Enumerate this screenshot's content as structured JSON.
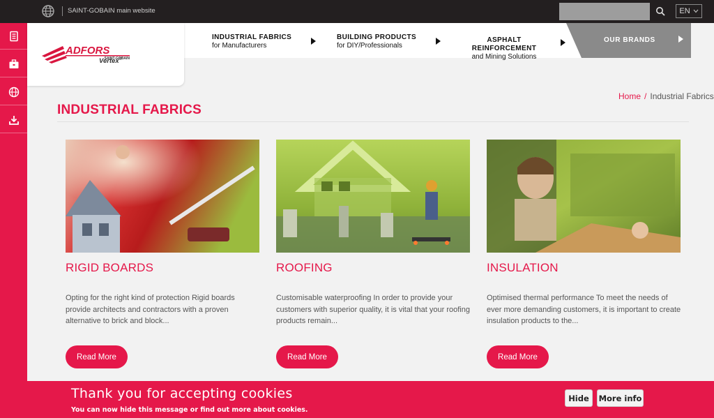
{
  "colors": {
    "brand": "#e5184a",
    "topbar": "#231f20",
    "brands_tab": "#8a8a8a"
  },
  "topbar": {
    "site_link": "SAINT-GOBAIN main website",
    "search_placeholder": "",
    "language": "EN",
    "icons": [
      "globe-icon",
      "search-icon",
      "chevron-down-icon"
    ]
  },
  "sidebar": {
    "items": [
      {
        "icon": "catalog-icon"
      },
      {
        "icon": "portfolio-icon"
      },
      {
        "icon": "globe-icon"
      },
      {
        "icon": "download-icon"
      }
    ]
  },
  "logo": {
    "brand": "ADFORS",
    "parent": "SAINT-GOBAIN",
    "product": "Vertex",
    "mark": "®"
  },
  "nav": {
    "items": [
      {
        "title": "INDUSTRIAL FABRICS",
        "subtitle": "for Manufacturers"
      },
      {
        "title": "BUILDING PRODUCTS",
        "subtitle": "for DIY/Professionals"
      },
      {
        "title": "ASPHALT REINFORCEMENT",
        "subtitle": "and Mining Solutions"
      }
    ],
    "brands_label": "OUR BRANDS"
  },
  "breadcrumb": {
    "home": "Home",
    "separator": "/",
    "current": "Industrial Fabrics"
  },
  "page": {
    "title": "INDUSTRIAL FABRICS"
  },
  "cards": [
    {
      "title": "RIGID BOARDS",
      "description": "Opting for the right kind of protection Rigid boards provide architects and contractors with a proven alternative to brick and block...",
      "button": "Read More"
    },
    {
      "title": "ROOFING",
      "description": "Customisable waterproofing In order to provide your customers with superior quality, it is vital that your roofing products remain...",
      "button": "Read More"
    },
    {
      "title": "INSULATION",
      "description": "Optimised thermal performance To meet the needs of ever more demanding customers, it is important to create insulation products to the...",
      "button": "Read More"
    }
  ],
  "cookie": {
    "title": "Thank you for accepting cookies",
    "text": "You can now hide this message or find out more about cookies.",
    "hide_label": "Hide",
    "more_label": "More info"
  }
}
